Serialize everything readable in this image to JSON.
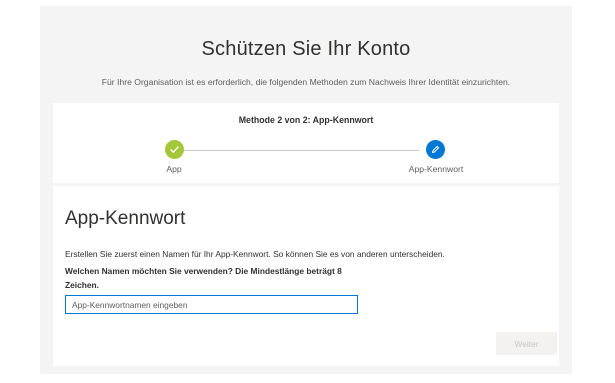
{
  "header": {
    "title": "Schützen Sie Ihr Konto",
    "subtitle": "Für Ihre Organisation ist es erforderlich, die folgenden Methoden zum Nachweis Ihrer Identität einzurichten."
  },
  "progress": {
    "header": "Methode 2 von 2: App-Kennwort",
    "steps": [
      {
        "label": "App",
        "status": "completed",
        "icon": "checkmark-icon",
        "color": "#a4c639"
      },
      {
        "label": "App-Kennwort",
        "status": "current",
        "icon": "pencil-icon",
        "color": "#0078d4"
      }
    ]
  },
  "form": {
    "title": "App-Kennwort",
    "description": "Erstellen Sie zuerst einen Namen für Ihr App-Kennwort. So können Sie es von anderen unterscheiden.",
    "question": "Welchen Namen möchten Sie verwenden? Die Mindestlänge beträgt 8 Zeichen.",
    "input": {
      "value": "",
      "placeholder": "App-Kennwortnamen eingeben"
    },
    "next_label": "Weiter",
    "next_enabled": false
  }
}
